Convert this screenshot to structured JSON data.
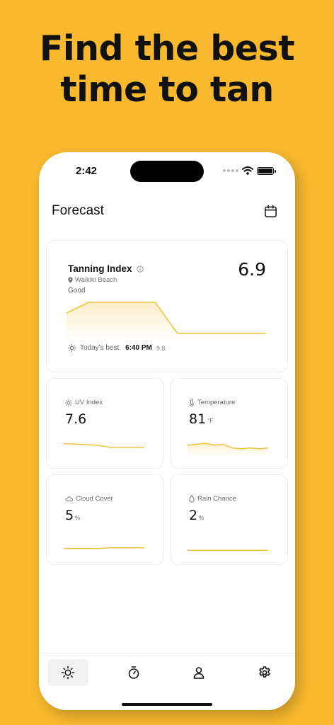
{
  "headline": {
    "line1": "Find the best",
    "line2": "time to tan"
  },
  "status_bar": {
    "time": "2:42"
  },
  "nav": {
    "title": "Forecast",
    "calendar_icon": "calendar-icon"
  },
  "main_card": {
    "title": "Tanning Index",
    "value": "6.9",
    "location": "Waikiki Beach",
    "rating": "Good",
    "best_label": "Today's best:",
    "best_time": "6:40 PM",
    "best_score": "9.8",
    "series": [
      6.9,
      9.8,
      9.8,
      9.8,
      9.8,
      1.4,
      1.4,
      1.4,
      1.4,
      1.4
    ]
  },
  "metrics": [
    {
      "name": "uv",
      "label": "UV Index",
      "value": "7.6",
      "unit": "",
      "icon": "sun-icon",
      "series": [
        7.6,
        7.3,
        6.9,
        6.4,
        5.2,
        5.2,
        5.2,
        5.2
      ]
    },
    {
      "name": "temperature",
      "label": "Temperature",
      "value": "81",
      "unit": "°F",
      "icon": "thermometer-icon",
      "series": [
        81,
        82,
        83,
        81,
        82,
        78,
        77,
        78,
        77,
        78
      ]
    },
    {
      "name": "cloud",
      "label": "Cloud Cover",
      "value": "5",
      "unit": "%",
      "icon": "cloud-icon",
      "series": [
        5,
        5,
        5,
        5,
        5,
        6,
        6,
        6,
        6,
        6
      ]
    },
    {
      "name": "rain",
      "label": "Rain Chance",
      "value": "2",
      "unit": "%",
      "icon": "droplet-icon",
      "series": [
        2,
        2,
        2,
        2,
        2,
        2,
        2,
        2,
        2,
        2
      ]
    }
  ],
  "tabs": [
    {
      "name": "forecast",
      "icon": "sun-icon",
      "active": true
    },
    {
      "name": "timer",
      "icon": "stopwatch-icon",
      "active": false
    },
    {
      "name": "profile",
      "icon": "person-icon",
      "active": false
    },
    {
      "name": "settings",
      "icon": "gear-icon",
      "active": false
    }
  ],
  "colors": {
    "background": "#F8B92E",
    "accent": "#F2C23A"
  }
}
